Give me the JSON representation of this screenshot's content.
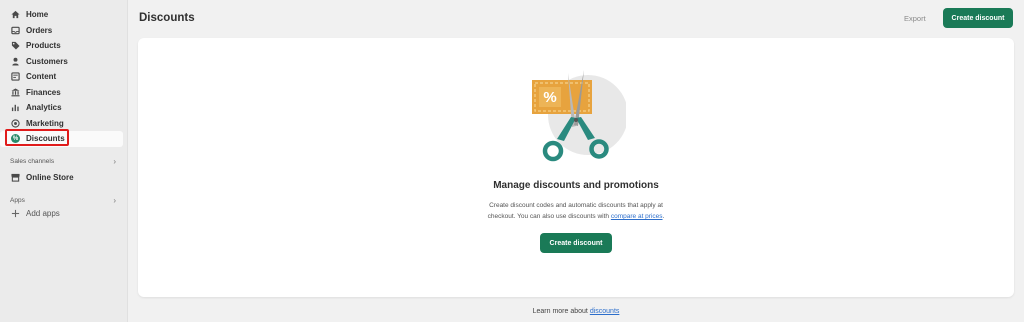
{
  "sidebar": {
    "items": [
      {
        "label": "Home",
        "icon": "home-icon"
      },
      {
        "label": "Orders",
        "icon": "orders-icon"
      },
      {
        "label": "Products",
        "icon": "tag-icon"
      },
      {
        "label": "Customers",
        "icon": "person-icon"
      },
      {
        "label": "Content",
        "icon": "content-icon"
      },
      {
        "label": "Finances",
        "icon": "bank-icon"
      },
      {
        "label": "Analytics",
        "icon": "bar-chart-icon"
      },
      {
        "label": "Marketing",
        "icon": "target-icon"
      },
      {
        "label": "Discounts",
        "icon": "discount-icon"
      }
    ],
    "sales_channels_label": "Sales channels",
    "online_store_label": "Online Store",
    "apps_label": "Apps",
    "add_apps_label": "Add apps"
  },
  "header": {
    "title": "Discounts",
    "export_label": "Export",
    "create_label": "Create discount"
  },
  "empty_state": {
    "heading": "Manage discounts and promotions",
    "desc_line1": "Create discount codes and automatic discounts that apply at",
    "desc_line2_prefix": "checkout. You can also use discounts with ",
    "desc_link": "compare at prices",
    "desc_line2_suffix": ".",
    "button_label": "Create discount"
  },
  "footer": {
    "prefix": "Learn more about ",
    "link": "discounts"
  },
  "colors": {
    "primary": "#1a7a57",
    "highlight": "#e01b1b",
    "link": "#2c6ecb"
  }
}
